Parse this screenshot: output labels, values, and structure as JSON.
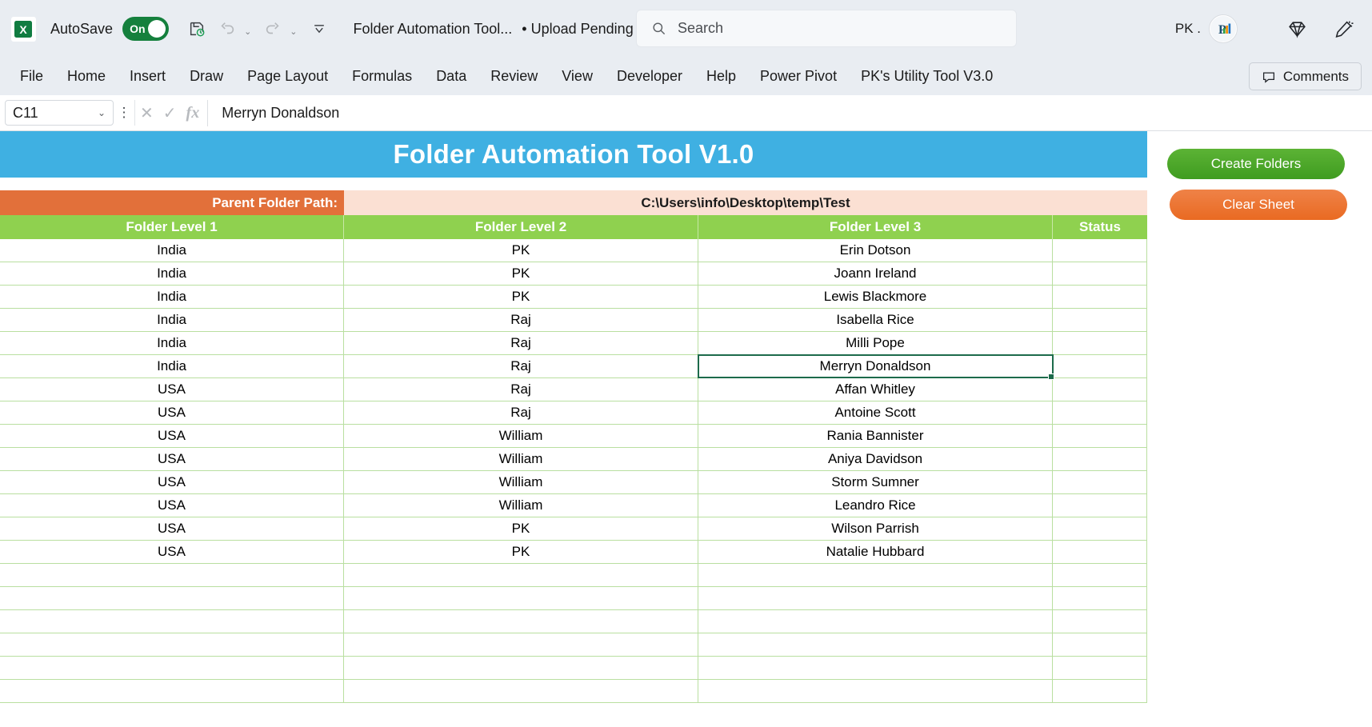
{
  "titlebar": {
    "app_icon": "excel-logo-icon",
    "autosave_label": "AutoSave",
    "autosave_state": "On",
    "save_icon": "save-refresh-icon",
    "undo_icon": "undo-icon",
    "redo_icon": "redo-icon",
    "customize_icon": "customize-quick-access-icon",
    "document_name": "Folder Automation Tool...",
    "document_status": "• Upload Pending",
    "status_chevron": "chevron-down-icon",
    "account_name": "PK .",
    "avatar_icon": "user-avatar-icon",
    "diamond_icon": "diamond-icon",
    "designer_icon": "pen-sparkle-icon"
  },
  "search": {
    "icon": "search-icon",
    "placeholder": "Search",
    "value": ""
  },
  "ribbon": {
    "tabs": [
      {
        "label": "File"
      },
      {
        "label": "Home"
      },
      {
        "label": "Insert"
      },
      {
        "label": "Draw"
      },
      {
        "label": "Page Layout"
      },
      {
        "label": "Formulas"
      },
      {
        "label": "Data"
      },
      {
        "label": "Review"
      },
      {
        "label": "View"
      },
      {
        "label": "Developer"
      },
      {
        "label": "Help"
      },
      {
        "label": "Power Pivot"
      },
      {
        "label": "PK's Utility Tool V3.0"
      }
    ],
    "comments_label": "Comments",
    "comments_icon": "comment-icon"
  },
  "formula_bar": {
    "name_box_value": "C11",
    "name_box_chevron": "chevron-down-icon",
    "more_icon": "vertical-dots-icon",
    "cancel_icon": "cancel-x-icon",
    "enter_icon": "enter-check-icon",
    "fx_label": "fx",
    "formula_value": "Merryn Donaldson"
  },
  "sheet": {
    "banner_title": "Folder Automation Tool V1.0",
    "banner_color": "#3fb0e2",
    "path_label": "Parent Folder Path:",
    "path_label_color": "#e2703a",
    "path_value": "C:\\Users\\info\\Desktop\\temp\\Test",
    "path_value_bg": "#fbe0d3",
    "header_color": "#8fd14f",
    "selected_cell": "C11",
    "headers": [
      "Folder Level 1",
      "Folder Level 2",
      "Folder Level 3",
      "Status"
    ],
    "rows": [
      {
        "level1": "India",
        "level2": "PK",
        "level3": "Erin Dotson",
        "status": ""
      },
      {
        "level1": "India",
        "level2": "PK",
        "level3": "Joann Ireland",
        "status": ""
      },
      {
        "level1": "India",
        "level2": "PK",
        "level3": "Lewis Blackmore",
        "status": ""
      },
      {
        "level1": "India",
        "level2": "Raj",
        "level3": "Isabella Rice",
        "status": ""
      },
      {
        "level1": "India",
        "level2": "Raj",
        "level3": "Milli Pope",
        "status": ""
      },
      {
        "level1": "India",
        "level2": "Raj",
        "level3": "Merryn Donaldson",
        "status": ""
      },
      {
        "level1": "USA",
        "level2": "Raj",
        "level3": "Affan Whitley",
        "status": ""
      },
      {
        "level1": "USA",
        "level2": "Raj",
        "level3": "Antoine Scott",
        "status": ""
      },
      {
        "level1": "USA",
        "level2": "William",
        "level3": "Rania Bannister",
        "status": ""
      },
      {
        "level1": "USA",
        "level2": "William",
        "level3": "Aniya Davidson",
        "status": ""
      },
      {
        "level1": "USA",
        "level2": "William",
        "level3": "Storm Sumner",
        "status": ""
      },
      {
        "level1": "USA",
        "level2": "William",
        "level3": "Leandro Rice",
        "status": ""
      },
      {
        "level1": "USA",
        "level2": "PK",
        "level3": "Wilson Parrish",
        "status": ""
      },
      {
        "level1": "USA",
        "level2": "PK",
        "level3": "Natalie Hubbard",
        "status": ""
      },
      {
        "level1": "",
        "level2": "",
        "level3": "",
        "status": ""
      },
      {
        "level1": "",
        "level2": "",
        "level3": "",
        "status": ""
      },
      {
        "level1": "",
        "level2": "",
        "level3": "",
        "status": ""
      },
      {
        "level1": "",
        "level2": "",
        "level3": "",
        "status": ""
      },
      {
        "level1": "",
        "level2": "",
        "level3": "",
        "status": ""
      },
      {
        "level1": "",
        "level2": "",
        "level3": "",
        "status": ""
      }
    ]
  },
  "actions": {
    "create_label": "Create Folders",
    "create_color": "#4aa62a",
    "clear_label": "Clear Sheet",
    "clear_color": "#e96a22"
  }
}
